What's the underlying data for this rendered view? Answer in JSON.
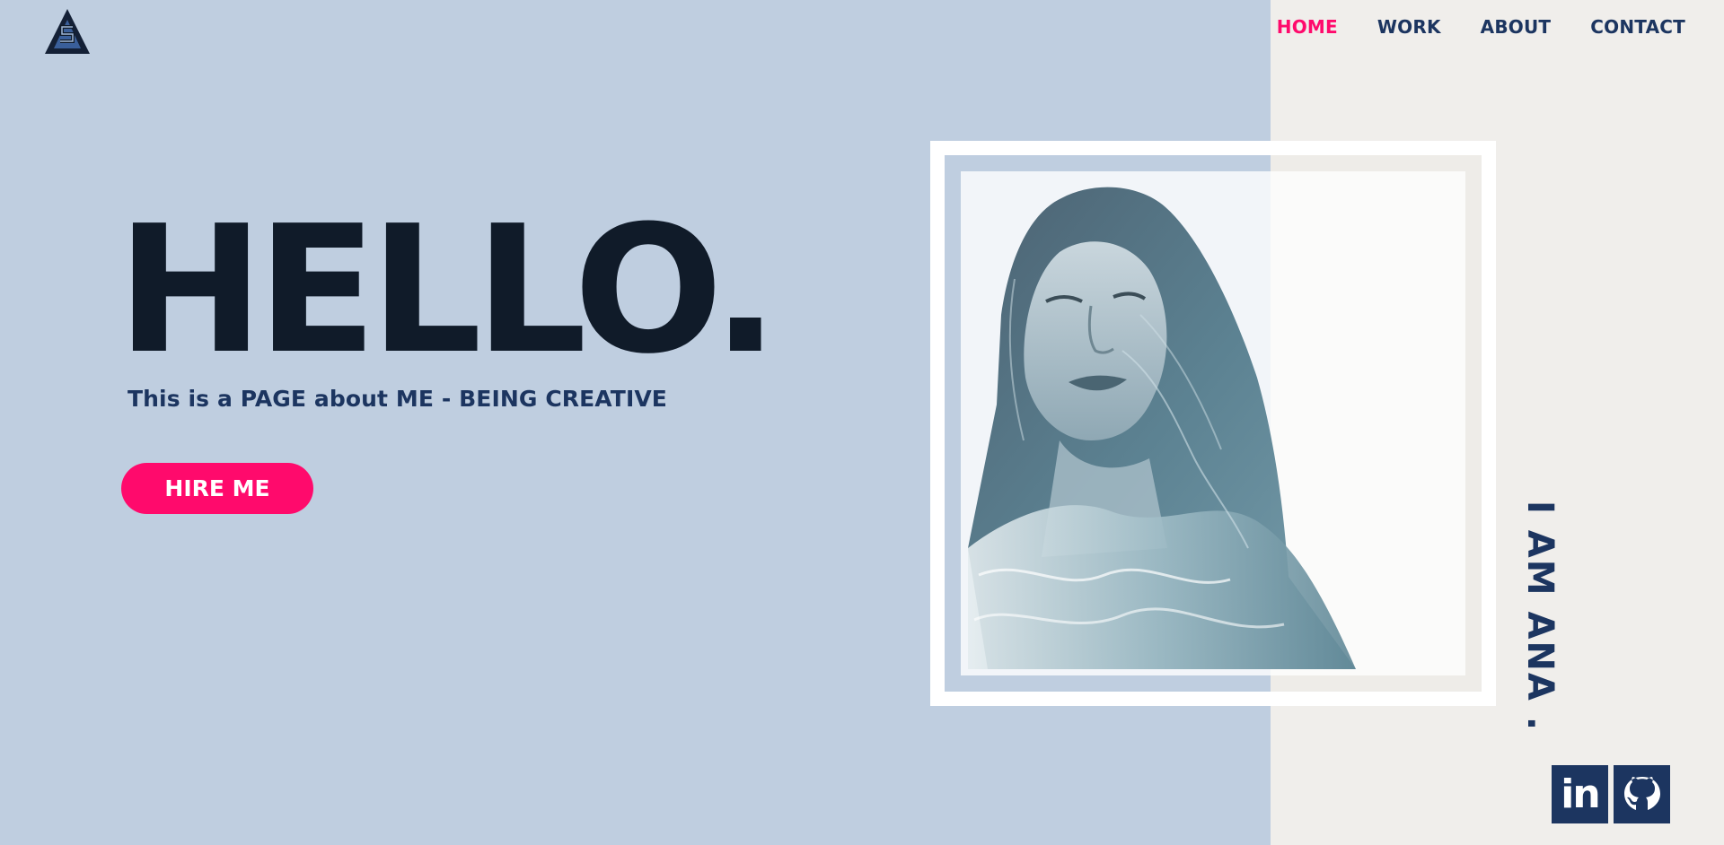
{
  "colors": {
    "background_left": "#bfcee0",
    "background_right": "#f0eeeb",
    "accent": "#ff0a6c",
    "navy": "#1c3560",
    "dark": "#101b29"
  },
  "logo": {
    "icon": "triangle-s-logo-icon"
  },
  "nav": {
    "items": [
      {
        "label": "HOME",
        "active": true
      },
      {
        "label": "WORK",
        "active": false
      },
      {
        "label": "ABOUT",
        "active": false
      },
      {
        "label": "CONTACT",
        "active": false
      }
    ]
  },
  "hero": {
    "title": "HELLO.",
    "subtitle": "This is a PAGE about ME - BEING CREATIVE",
    "cta_label": "HIRE ME"
  },
  "side": {
    "name_text": "I AM ANA ."
  },
  "social": {
    "linkedin_label": "in",
    "linkedin_icon": "linkedin-icon",
    "github_icon": "github-icon"
  }
}
